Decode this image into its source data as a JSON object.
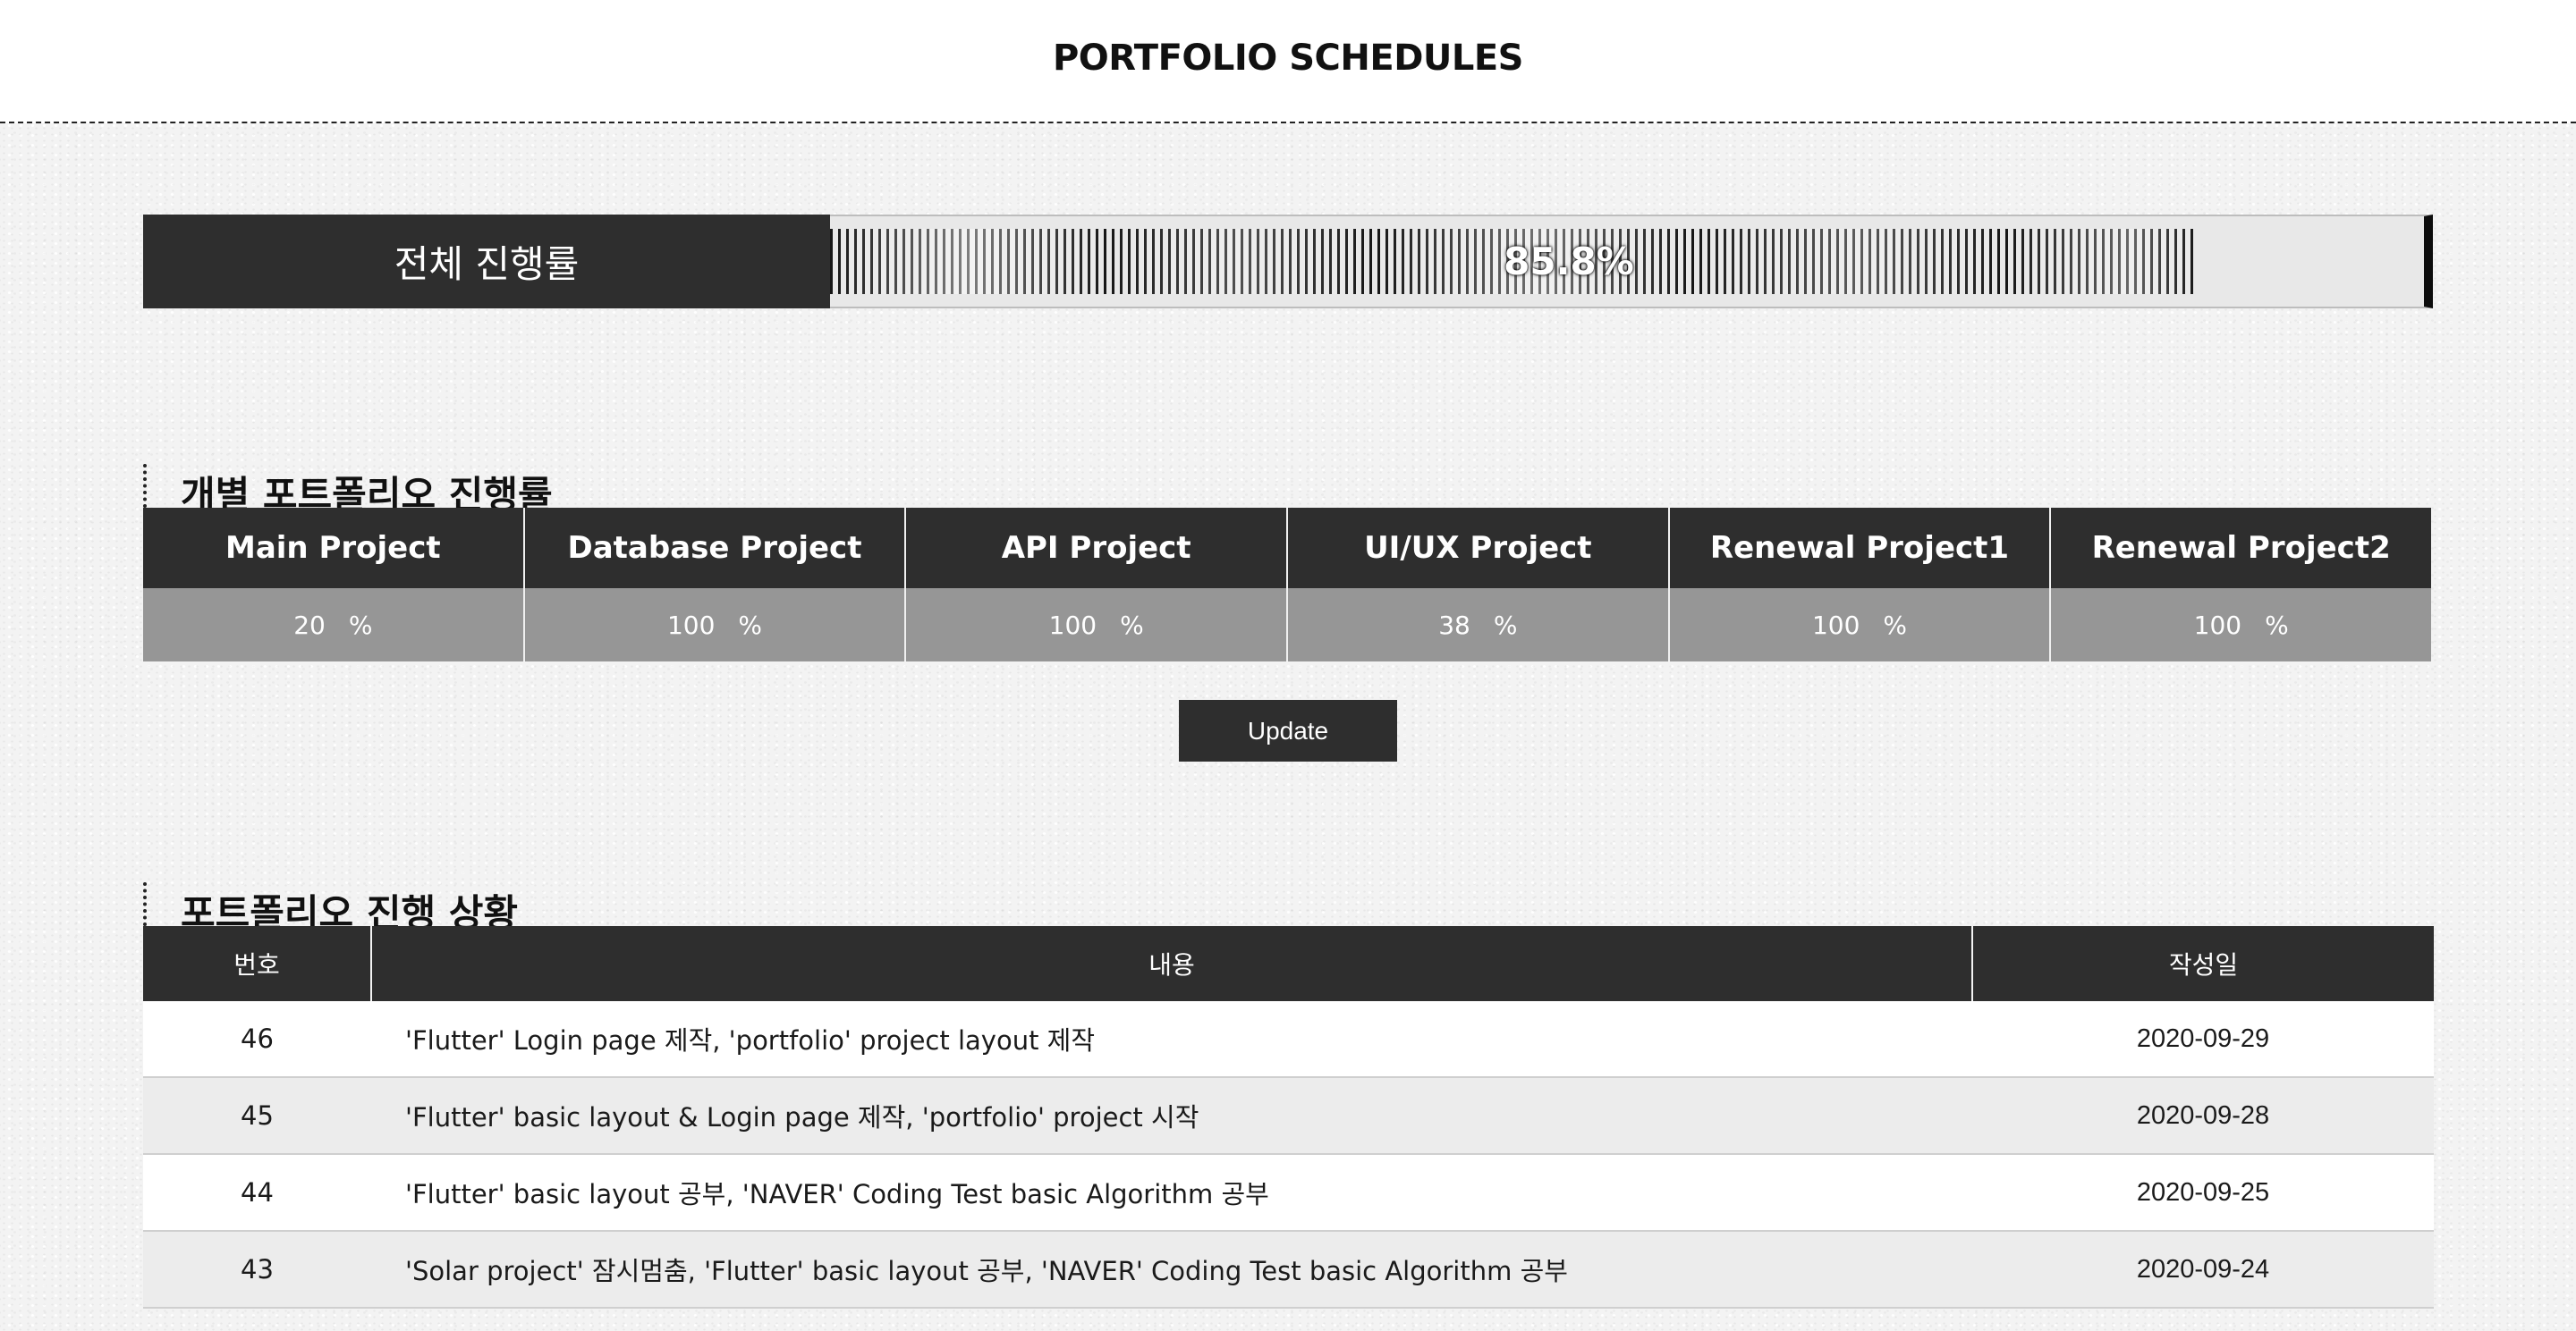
{
  "header": {
    "title": "PORTFOLIO SCHEDULES"
  },
  "overall": {
    "label": "전체 진행률",
    "percent_text": "85.8%",
    "progress": 0.858
  },
  "sections": {
    "projects_heading": "개별 포트폴리오 진행률",
    "log_heading": "포트폴리오 진행 상황"
  },
  "projects": [
    {
      "name": "Main Project",
      "value": "20",
      "unit": "%"
    },
    {
      "name": "Database Project",
      "value": "100",
      "unit": "%"
    },
    {
      "name": "API Project",
      "value": "100",
      "unit": "%"
    },
    {
      "name": "UI/UX Project",
      "value": "38",
      "unit": "%"
    },
    {
      "name": "Renewal Project1",
      "value": "100",
      "unit": "%"
    },
    {
      "name": "Renewal Project2",
      "value": "100",
      "unit": "%"
    }
  ],
  "update_button": {
    "label": "Update"
  },
  "log_table": {
    "columns": [
      "번호",
      "내용",
      "작성일"
    ],
    "rows": [
      {
        "no": "46",
        "content": "'Flutter' Login page 제작, 'portfolio' project layout 제작",
        "date": "2020-09-29"
      },
      {
        "no": "45",
        "content": "'Flutter' basic layout & Login page 제작, 'portfolio' project 시작",
        "date": "2020-09-28"
      },
      {
        "no": "44",
        "content": "'Flutter' basic layout 공부, 'NAVER' Coding Test basic Algorithm 공부",
        "date": "2020-09-25"
      },
      {
        "no": "43",
        "content": "'Solar project' 잠시멈춤, 'Flutter' basic layout 공부, 'NAVER' Coding Test basic Algorithm 공부",
        "date": "2020-09-24"
      }
    ]
  }
}
